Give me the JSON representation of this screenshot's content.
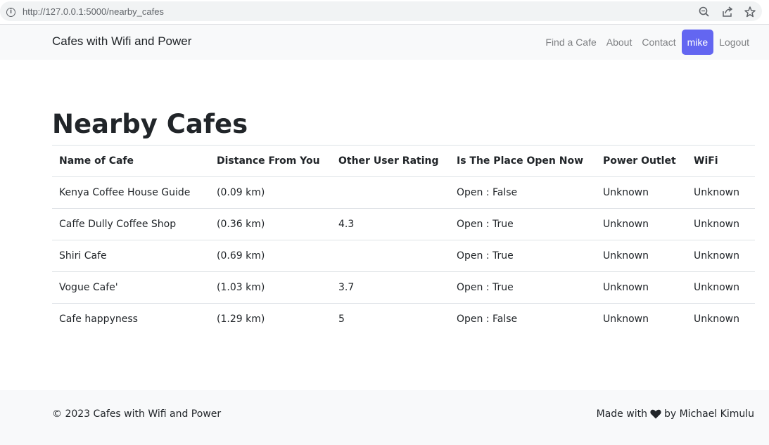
{
  "browser": {
    "url": "http://127.0.0.1:5000/nearby_cafes"
  },
  "navbar": {
    "brand": "Cafes with Wifi and Power",
    "links": [
      "Find a Cafe",
      "About",
      "Contact"
    ],
    "user": "mike",
    "logout": "Logout",
    "accent_color": "#6366f1"
  },
  "main": {
    "title": "Nearby Cafes",
    "table": {
      "headers": [
        "Name of Cafe",
        "Distance From You",
        "Other User Rating",
        "Is The Place Open Now",
        "Power Outlet",
        "WiFi"
      ],
      "rows": [
        [
          "Kenya Coffee House Guide",
          "(0.09 km)",
          "",
          "Open : False",
          "Unknown",
          "Unknown"
        ],
        [
          "Caffe Dully Coffee Shop",
          "(0.36 km)",
          "4.3",
          "Open : True",
          "Unknown",
          "Unknown"
        ],
        [
          "Shiri Cafe",
          "(0.69 km)",
          "",
          "Open : True",
          "Unknown",
          "Unknown"
        ],
        [
          "Vogue Cafe'",
          "(1.03 km)",
          "3.7",
          "Open : True",
          "Unknown",
          "Unknown"
        ],
        [
          "Cafe happyness",
          "(1.29 km)",
          "5",
          "Open : False",
          "Unknown",
          "Unknown"
        ]
      ]
    }
  },
  "footer": {
    "copyright": "© 2023 Cafes with Wifi and Power",
    "made_prefix": "Made with",
    "made_suffix": "by Michael Kimulu",
    "heart_icon": "heart-icon"
  }
}
